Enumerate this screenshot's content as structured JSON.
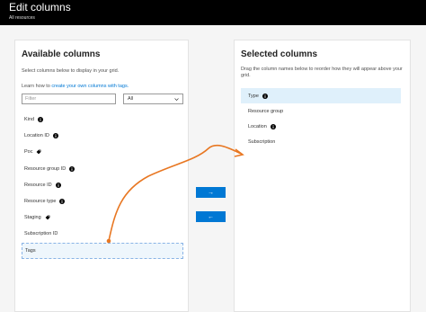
{
  "header": {
    "title": "Edit columns",
    "subtitle": "All resources"
  },
  "available": {
    "title": "Available columns",
    "description": "Select columns below to display in your grid.",
    "learn_prefix": "Learn how to ",
    "learn_link": "create your own columns with tags.",
    "filter_placeholder": "Filter",
    "select_value": "All",
    "items": [
      {
        "label": "Kind",
        "icon": "info-icon"
      },
      {
        "label": "Location ID",
        "icon": "info-icon"
      },
      {
        "label": "Poc",
        "icon": "tag-icon"
      },
      {
        "label": "Resource group ID",
        "icon": "info-icon"
      },
      {
        "label": "Resource ID",
        "icon": "info-icon"
      },
      {
        "label": "Resource type",
        "icon": "info-icon"
      },
      {
        "label": "Staging",
        "icon": "tag-icon"
      },
      {
        "label": "Subscription ID",
        "icon": ""
      },
      {
        "label": "Tags",
        "icon": ""
      }
    ]
  },
  "selected": {
    "title": "Selected columns",
    "description": "Drag the column names below to reorder how they will appear above your grid.",
    "items": [
      {
        "label": "Type",
        "icon": "info-icon"
      },
      {
        "label": "Resource group",
        "icon": ""
      },
      {
        "label": "Location",
        "icon": "info-icon"
      },
      {
        "label": "Subscription",
        "icon": ""
      }
    ]
  },
  "buttons": {
    "add_label": "→",
    "remove_label": "←"
  },
  "colors": {
    "accent": "#0078d4",
    "annotation_arrow": "#e87722",
    "header_bg": "#000000",
    "highlight_row": "#dff0fb"
  }
}
